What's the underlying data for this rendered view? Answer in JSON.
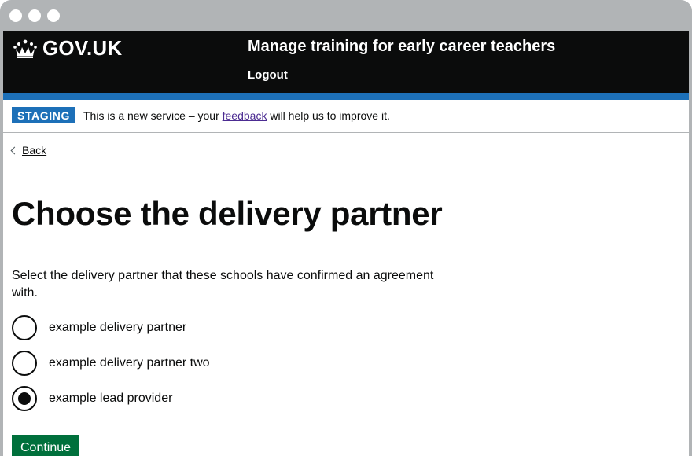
{
  "header": {
    "logo_text": "GOV.UK",
    "service_name": "Manage training for early career teachers",
    "logout_label": "Logout"
  },
  "phase_banner": {
    "tag": "STAGING",
    "text_before": "This is a new service – your ",
    "link_text": "feedback",
    "text_after": " will help us to improve it."
  },
  "back_link": "Back",
  "page_title": "Choose the delivery partner",
  "hint": "Select the delivery partner that these schools have confirmed an agreement with.",
  "options": [
    {
      "label": "example delivery partner",
      "checked": false
    },
    {
      "label": "example delivery partner two",
      "checked": false
    },
    {
      "label": "example lead provider",
      "checked": true
    }
  ],
  "continue_label": "Continue",
  "colors": {
    "header_bg": "#0b0c0c",
    "accent_blue": "#1d70b8",
    "button_green": "#00703c",
    "link_visited": "#4c2c92"
  }
}
